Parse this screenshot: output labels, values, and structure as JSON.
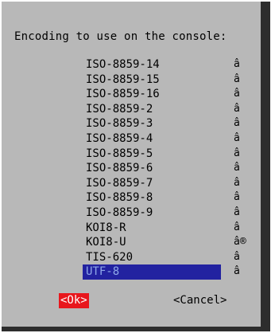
{
  "dialog": {
    "prompt": "Encoding to use on the console:",
    "items": [
      {
        "label": "ISO-8859-14",
        "mark": "â"
      },
      {
        "label": "ISO-8859-15",
        "mark": "â"
      },
      {
        "label": "ISO-8859-16",
        "mark": "â"
      },
      {
        "label": "ISO-8859-2",
        "mark": "â"
      },
      {
        "label": "ISO-8859-3",
        "mark": "â"
      },
      {
        "label": "ISO-8859-4",
        "mark": "â"
      },
      {
        "label": "ISO-8859-5",
        "mark": "â"
      },
      {
        "label": "ISO-8859-6",
        "mark": "â"
      },
      {
        "label": "ISO-8859-7",
        "mark": "â"
      },
      {
        "label": "ISO-8859-8",
        "mark": "â"
      },
      {
        "label": "ISO-8859-9",
        "mark": "â"
      },
      {
        "label": "KOI8-R",
        "mark": "â"
      },
      {
        "label": "KOI8-U",
        "mark": "â®"
      },
      {
        "label": "TIS-620",
        "mark": "â"
      },
      {
        "label": "UTF-8",
        "mark": "â"
      }
    ],
    "selected_label": "UTF-8",
    "ok_label": "<Ok>",
    "cancel_label": "<Cancel>",
    "colors": {
      "background": "#b8b8b8",
      "shadow": "#2d2d2d",
      "selection_bg": "#2222a0",
      "selection_text": "#8fa8e8",
      "ok_bg": "#e8161c",
      "ok_text": "#ffffff"
    }
  }
}
